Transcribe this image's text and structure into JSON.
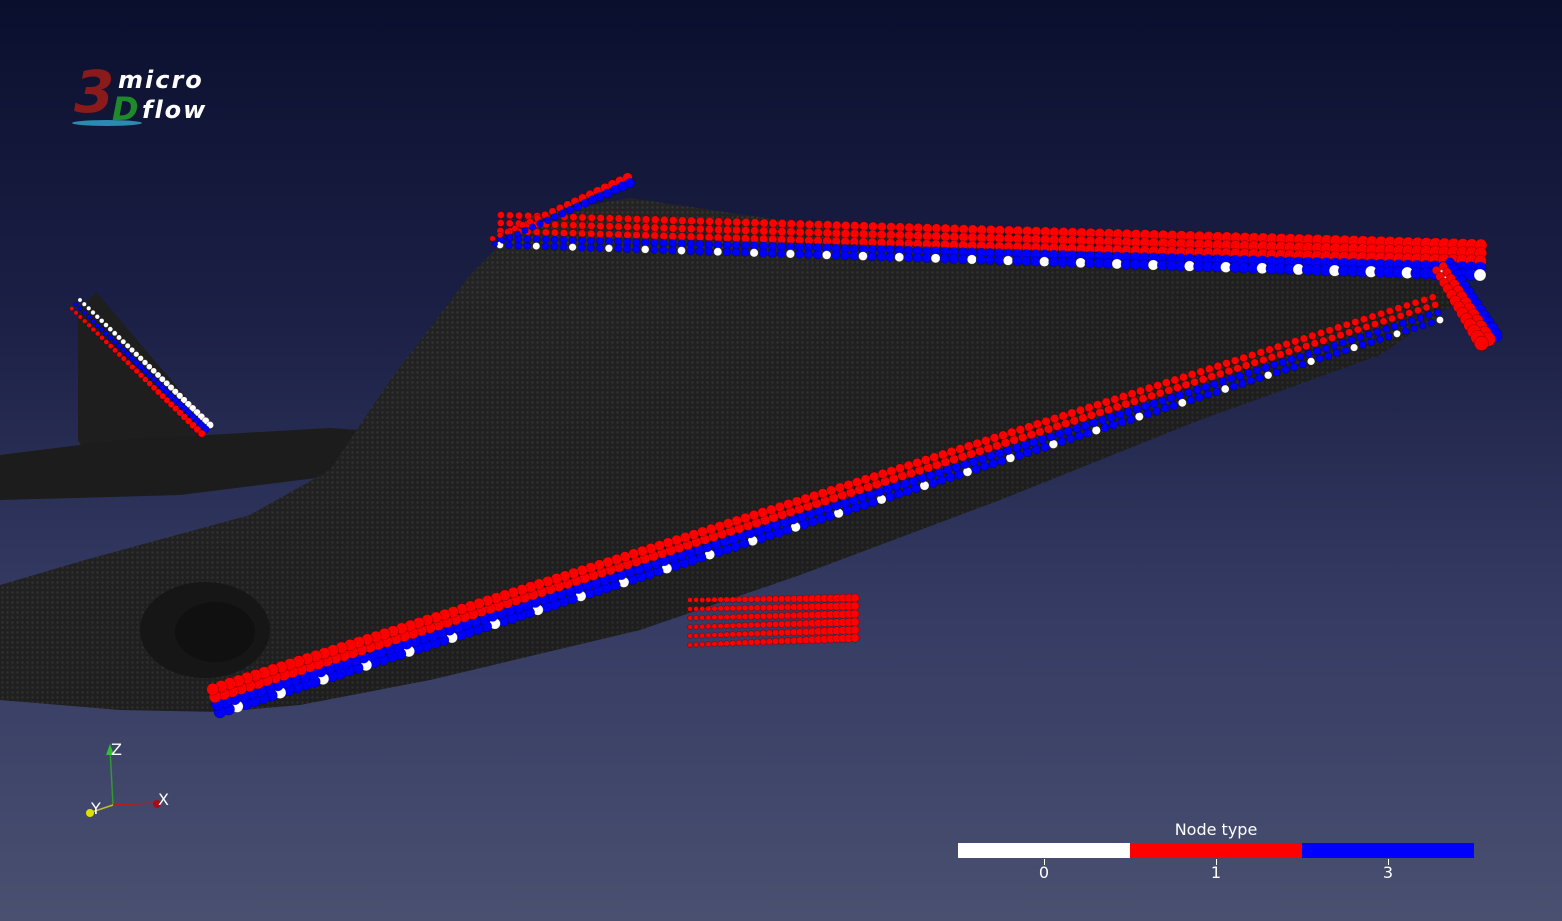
{
  "logo": {
    "digit": "3",
    "letter": "D",
    "word_top": "micro",
    "word_bottom": "flow"
  },
  "axes": {
    "z_label": "Z",
    "y_label": "Y",
    "x_label": "X"
  },
  "legend": {
    "title": "Node type",
    "entries": [
      {
        "label": "0",
        "color": "#ffffff"
      },
      {
        "label": "1",
        "color": "#ff0000"
      },
      {
        "label": "3",
        "color": "#0000ff"
      }
    ]
  },
  "colors": {
    "body": "#2b2b2b",
    "node_0": "#ffffff",
    "node_1": "#ff0000",
    "node_3": "#0000ff"
  }
}
